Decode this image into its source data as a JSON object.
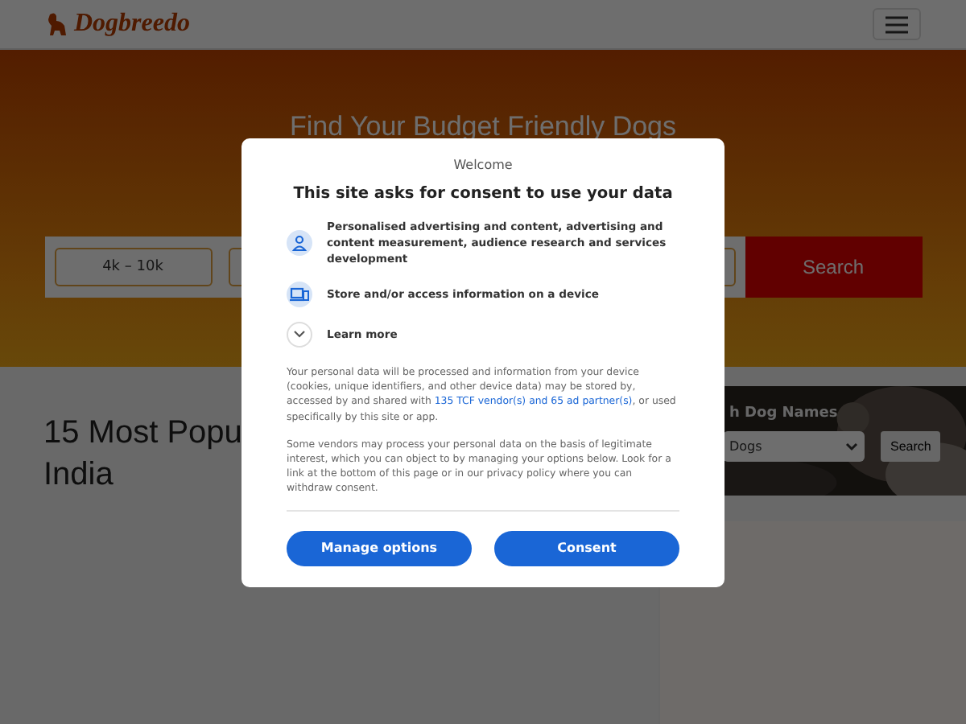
{
  "header": {
    "logo": "Dogbreedo"
  },
  "hero": {
    "heading": "Find Your Budget Friendly Dogs",
    "price_field": {
      "value": "4k – 10k"
    },
    "search_button": "Search"
  },
  "article": {
    "title_lines": [
      "15 Most Popu",
      "India"
    ]
  },
  "sidebar": {
    "title": "h Dog Names",
    "select": {
      "value": "Dogs"
    },
    "search_button": "Search"
  },
  "consent": {
    "welcome": "Welcome",
    "title": "This site asks for consent to use your data",
    "purposes": [
      {
        "kind": "person",
        "text": "Personalised advertising and content, advertising and content measurement, audience research and services development"
      },
      {
        "kind": "device",
        "text": "Store and/or access information on a device"
      }
    ],
    "learn_more": {
      "label": "Learn more",
      "expanded": false
    },
    "paragraph_1": {
      "before": "Your personal data will be processed and information from your device (cookies, unique identifiers, and other device data) may be stored by, accessed by and shared with",
      "link": "135 TCF vendor(s) and 65 ad partner(s)",
      "after": ", or used specifically by this site or app."
    },
    "paragraph_2": "Some vendors may process your personal data on the basis of legitimate interest, which you can object to by managing your options below. Look for a link at the bottom of this page or in our privacy policy where you can withdraw consent.",
    "buttons": [
      "Manage options",
      "Consent"
    ]
  }
}
